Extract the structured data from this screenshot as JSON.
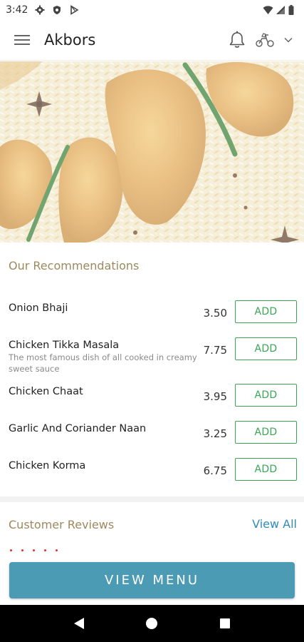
{
  "status_bar": {
    "time": "3:42",
    "left_icons": [
      "gear-icon",
      "shield-icon",
      "play-store-icon"
    ],
    "right_icons": [
      "wifi-icon",
      "signal-icon",
      "battery-icon"
    ]
  },
  "app_bar": {
    "title": "Akbors",
    "icons": [
      "hamburger-menu-icon",
      "bell-icon",
      "scooter-icon",
      "chevron-down-icon"
    ]
  },
  "hero": {
    "image": "biryani-food-photo"
  },
  "recommendations": {
    "title": "Our Recommendations",
    "items": [
      {
        "name": "Onion Bhaji",
        "description": "",
        "price": "3.50",
        "button": "ADD"
      },
      {
        "name": "Chicken Tikka Masala",
        "description": "The most famous dish of all cooked in creamy sweet sauce",
        "price": "7.75",
        "button": "ADD"
      },
      {
        "name": "Chicken Chaat",
        "description": "",
        "price": "3.95",
        "button": "ADD"
      },
      {
        "name": "Garlic And Coriander Naan",
        "description": "",
        "price": "3.25",
        "button": "ADD"
      },
      {
        "name": "Chicken Korma",
        "description": "",
        "price": "6.75",
        "button": "ADD"
      }
    ]
  },
  "reviews": {
    "title": "Customer Reviews",
    "view_all": "View All"
  },
  "view_menu_button": "VIEW MENU",
  "nav_bar": {
    "icons": [
      "back-icon",
      "home-icon",
      "recents-icon"
    ]
  },
  "colors": {
    "accent_gold": "#9c8a5e",
    "add_green": "#3aa655",
    "link_blue": "#2f8bb8",
    "view_menu_bg": "#4c9bb5"
  }
}
